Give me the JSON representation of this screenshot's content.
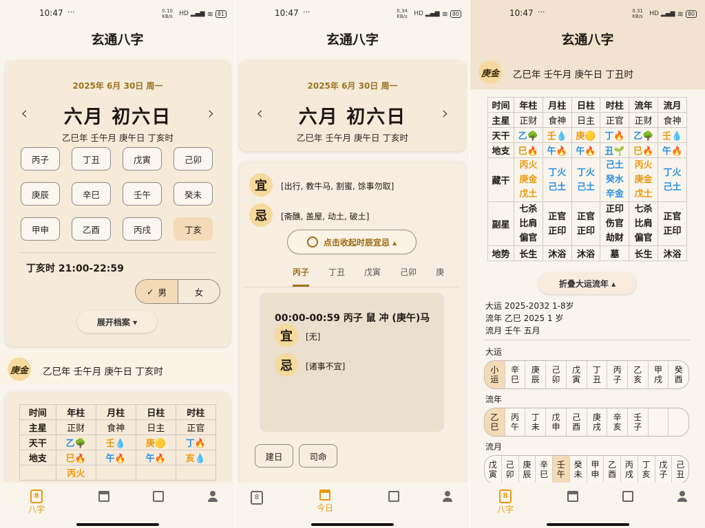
{
  "status": {
    "time": "10:47",
    "dots": "···",
    "p1_speed": "0.10 KB/s",
    "p2_speed": "0.34 KB/s",
    "p3_speed": "0.31 KB/s",
    "p1_batt": "81",
    "p2_batt": "80",
    "p3_batt": "80",
    "net": "HD ▂▄▆",
    "wifi": "≋"
  },
  "app_title": "玄通八字",
  "date_header": {
    "gregorian": "2025年 6月 30日 周一",
    "lunar": "六月 初六日",
    "ganzhi": "乙巳年 壬午月 庚午日 丁亥时",
    "prev": "‹",
    "next": "›"
  },
  "hours": [
    "丙子",
    "丁丑",
    "戊寅",
    "己卯",
    "庚辰",
    "辛巳",
    "壬午",
    "癸未",
    "甲申",
    "乙酉",
    "丙戌",
    "丁亥"
  ],
  "hour_info": "丁亥时 21:00-22:59",
  "gender": {
    "check": "✓",
    "male": "男",
    "female": "女"
  },
  "expand_label": "展开档案 ▾",
  "daymaster": {
    "badge": "庚金",
    "text_p1": "乙巳年 壬午月 庚午日 丁亥时",
    "text_p3": "乙巳年 壬午月 庚午日 丁丑时"
  },
  "p1_table": {
    "header": [
      "时间",
      "年柱",
      "月柱",
      "日柱",
      "时柱"
    ],
    "rows": [
      [
        "主星",
        "正财",
        "食神",
        "日主",
        "正官"
      ],
      [
        "天干",
        "乙🌳",
        "壬💧",
        "庚🟡",
        "丁🔥"
      ],
      [
        "地支",
        "巳🔥",
        "午🔥",
        "午🔥",
        "亥💧"
      ],
      [
        "",
        "丙火",
        "",
        "",
        ""
      ]
    ]
  },
  "yiji": {
    "yi_char": "宜",
    "ji_char": "忌",
    "yi": "[出行, 教牛马, 割蜜, 馀事勿取]",
    "ji": "[斋醮, 盖屋, 动土, 破土]",
    "toggle": "点击收起时辰宜忌 ▴",
    "clock_icon": "clock-icon"
  },
  "hour_tabs": [
    "丙子",
    "丁丑",
    "戊寅",
    "己卯",
    "庚"
  ],
  "hour_detail": {
    "title": "00:00-00:59 丙子 鼠 冲 (庚午)马",
    "yi": "[无]",
    "ji": "[诸事不宜]"
  },
  "chips": [
    "建日",
    "司命"
  ],
  "p3_table": {
    "header": [
      "时间",
      "年柱",
      "月柱",
      "日柱",
      "时柱",
      "流年",
      "流月"
    ],
    "main_star": [
      "主星",
      "正财",
      "食神",
      "日主",
      "正官",
      "正财",
      "食神"
    ],
    "tiangan": [
      "天干",
      "乙🌳",
      "壬💧",
      "庚🟡",
      "丁🔥",
      "乙🌳",
      "壬💧"
    ],
    "dizhi": [
      "地支",
      "巳🔥",
      "午🔥",
      "午🔥",
      "丑🌱",
      "巳🔥",
      "午🔥"
    ],
    "canggan_label": "藏干",
    "canggan": [
      [
        "丙火",
        "庚金",
        "戊土"
      ],
      [
        "丁火",
        "己土"
      ],
      [
        "丁火",
        "己土"
      ],
      [
        "己土",
        "癸水",
        "辛金"
      ],
      [
        "丙火",
        "庚金",
        "戊土"
      ],
      [
        "丁火",
        "己土"
      ]
    ],
    "fuxing_label": "副星",
    "fuxing": [
      [
        "七杀",
        "比肩",
        "偏官"
      ],
      [
        "正官",
        "正印"
      ],
      [
        "正官",
        "正印"
      ],
      [
        "正印",
        "伤官",
        "劫财"
      ],
      [
        "七杀",
        "比肩",
        "偏官"
      ],
      [
        "正官",
        "正印"
      ]
    ],
    "dishi": [
      "地势",
      "长生",
      "沐浴",
      "沐浴",
      "墓",
      "长生",
      "沐浴"
    ]
  },
  "luck": {
    "fold": "折叠大运流年 ▴",
    "dayun_info": "大运  2025-2032 1-8岁",
    "liunian_info": "流年  乙巳 2025 1 岁",
    "liuyue_info": "流月  壬午 五月",
    "dayun_label": "大运",
    "liunian_label": "流年",
    "liuyue_label": "流月",
    "dayun": [
      [
        "小",
        "运"
      ],
      [
        "辛",
        "巳"
      ],
      [
        "庚",
        "辰"
      ],
      [
        "己",
        "卯"
      ],
      [
        "戊",
        "寅"
      ],
      [
        "丁",
        "丑"
      ],
      [
        "丙",
        "子"
      ],
      [
        "乙",
        "亥"
      ],
      [
        "甲",
        "戌"
      ],
      [
        "癸",
        "酉"
      ]
    ],
    "liunian": [
      [
        "乙",
        "巳"
      ],
      [
        "丙",
        "午"
      ],
      [
        "丁",
        "未"
      ],
      [
        "戊",
        "申"
      ],
      [
        "己",
        "酉"
      ],
      [
        "庚",
        "戌"
      ],
      [
        "辛",
        "亥"
      ],
      [
        "壬",
        "子"
      ],
      [
        "",
        ""
      ],
      [
        "",
        ""
      ]
    ],
    "liuyue": [
      [
        "戊",
        "寅"
      ],
      [
        "己",
        "卯"
      ],
      [
        "庚",
        "辰"
      ],
      [
        "辛",
        "巳"
      ],
      [
        "壬",
        "午"
      ],
      [
        "癸",
        "未"
      ],
      [
        "甲",
        "申"
      ],
      [
        "乙",
        "酉"
      ],
      [
        "丙",
        "戌"
      ],
      [
        "丁",
        "亥"
      ],
      [
        "戊",
        "子"
      ],
      [
        "己",
        "丑"
      ]
    ]
  },
  "nav": {
    "bazi": "八字",
    "today": "今日",
    "icons": [
      "bazi-icon",
      "calendar-icon",
      "search-calendar-icon",
      "person-icon"
    ]
  },
  "colors": {
    "accent": "#e89a10",
    "card": "#f6ead9",
    "badge": "#f6d99d",
    "bg": "#f9f4ec"
  }
}
